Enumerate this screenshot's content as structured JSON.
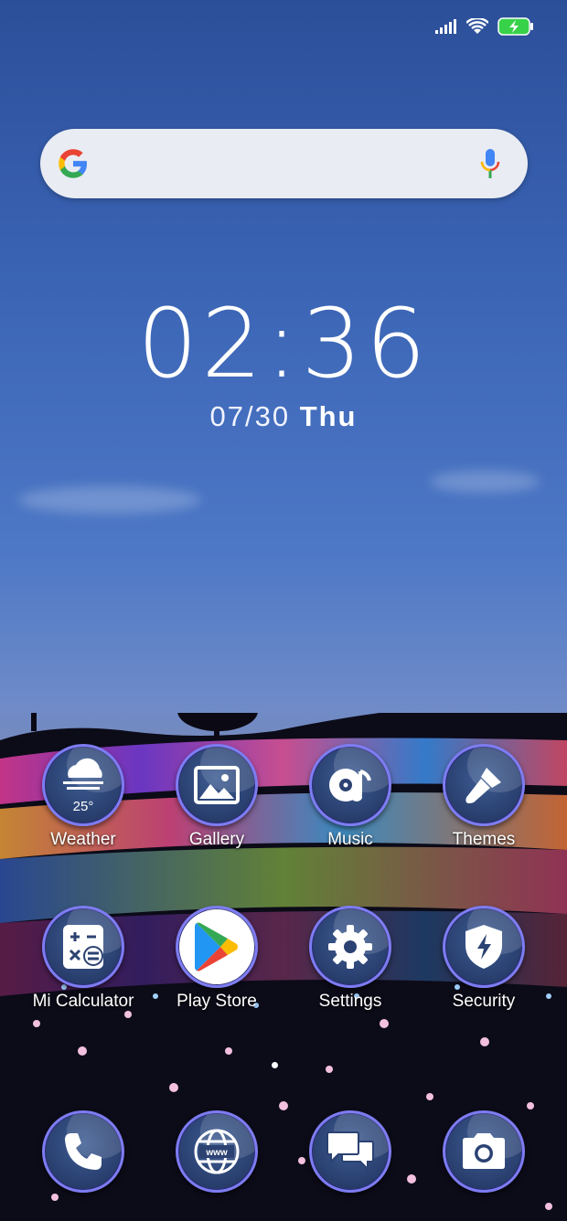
{
  "status_bar": {
    "signal": "signal-icon",
    "wifi": "wifi-icon",
    "battery": "battery-charging-icon"
  },
  "search": {
    "logo": "google-logo",
    "mic": "mic-icon"
  },
  "clock": {
    "time": "02:36",
    "date_num": "07/30",
    "day": "Thu"
  },
  "apps_row1": [
    {
      "label": "Weather",
      "icon": "weather-icon",
      "temp": "25°"
    },
    {
      "label": "Gallery",
      "icon": "gallery-icon"
    },
    {
      "label": "Music",
      "icon": "music-icon"
    },
    {
      "label": "Themes",
      "icon": "themes-icon"
    }
  ],
  "apps_row2": [
    {
      "label": "Mi Calculator",
      "icon": "calculator-icon"
    },
    {
      "label": "Play Store",
      "icon": "play-store-icon"
    },
    {
      "label": "Settings",
      "icon": "settings-icon"
    },
    {
      "label": "Security",
      "icon": "security-icon"
    }
  ],
  "dock": [
    {
      "icon": "phone-icon"
    },
    {
      "icon": "browser-icon",
      "text": "www"
    },
    {
      "icon": "messages-icon"
    },
    {
      "icon": "camera-icon"
    }
  ],
  "colors": {
    "accent_ring": "#7d7cf1",
    "battery": "#38d24a"
  }
}
